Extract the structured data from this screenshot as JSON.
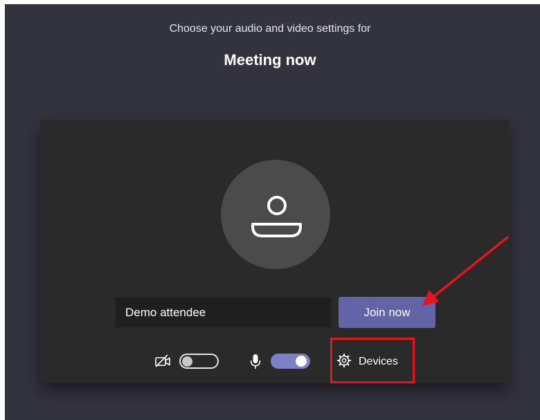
{
  "header": {
    "subtitle": "Choose your audio and video settings for",
    "title": "Meeting now"
  },
  "join": {
    "name_value": "Demo attendee",
    "join_label": "Join now"
  },
  "controls": {
    "camera_icon": "camera-off-icon",
    "camera_on": false,
    "mic_icon": "microphone-icon",
    "mic_on": true,
    "devices_icon": "gear-icon",
    "devices_label": "Devices"
  },
  "annotations": {
    "highlight_color": "#e8141a",
    "arrow_color": "#e8141a"
  },
  "colors": {
    "background": "#33323f",
    "preview": "#2a2a2a",
    "accent": "#6264a7",
    "toggle_on": "#7e80c7"
  }
}
